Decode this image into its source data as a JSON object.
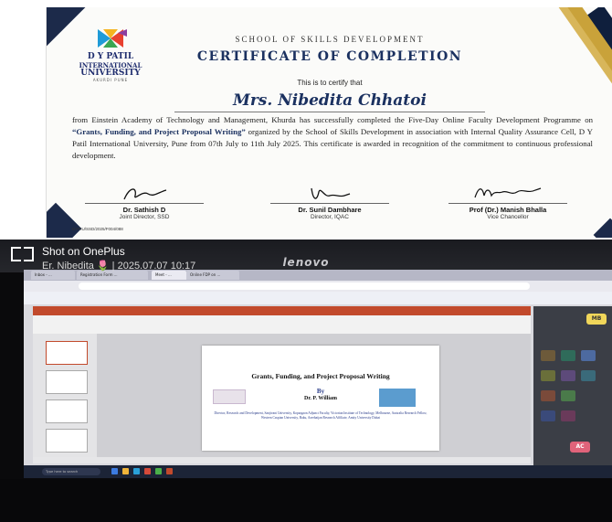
{
  "certificate": {
    "logo": {
      "line1": "D Y PATIL",
      "line2": "INTERNATIONAL",
      "line3": "UNIVERSITY",
      "line4": "AKURDI PUNE"
    },
    "school": "SCHOOL OF SKILLS DEVELOPMENT",
    "title": "CERTIFICATE OF COMPLETION",
    "certify_text": "This is to certify that",
    "recipient": "Mrs. Nibedita Chhatoi",
    "body_pre": "from Einstein Academy of Technology and Management, Khurda has successfully completed the Five-Day Online Faculty Development Programme on ",
    "body_program": "“Grants, Funding, and Project Proposal Writing”",
    "body_post": " organized by the School of Skills Development in association with Internal Quality Assurance Cell, D Y Patil International University, Pune from 07th July to 11th July 2025. This certificate is awarded in recognition of the commitment to continuous professional development.",
    "signatories": [
      {
        "name": "Dr. Sathish D",
        "role": "Joint Director, SSD"
      },
      {
        "name": "Dr. Sunil Dambhare",
        "role": "Director, IQAC"
      },
      {
        "name": "Prof (Dr.) Manish Bhalla",
        "role": "Vice Chancellor"
      }
    ],
    "reference": "DYPIU/SSD/2025/F004/088"
  },
  "photo": {
    "monitor_brand": "lenovo",
    "browser_tabs": [
      "Inbox - ...",
      "Registration Form ...",
      "Meet - ...",
      "Online FDP on ..."
    ],
    "slide": {
      "title": "Grants, Funding, and Project Proposal Writing",
      "by": "By",
      "presenter": "Dr. P. William",
      "affiliation": "Director, Research and Development, Sanjivani University, Kopargaon Adjunct Faculty, Victorian Institute of Technology, Melbourne, Australia Research Fellow, Western Caspian University, Baku, Azerbaijan Research Affiliate, Amity University Dubai"
    },
    "participant_avatars": [
      "MB",
      "AC"
    ],
    "taskbar_search": "Type here to search",
    "watermark_line1": "Shot on OnePlus",
    "watermark_line2": "Er. Nibedita 🌷 | 2025.07.07 10:17"
  },
  "colors": {
    "navy": "#1b3160",
    "gold": "#c9a23a",
    "ppt_red": "#c24a2c"
  }
}
